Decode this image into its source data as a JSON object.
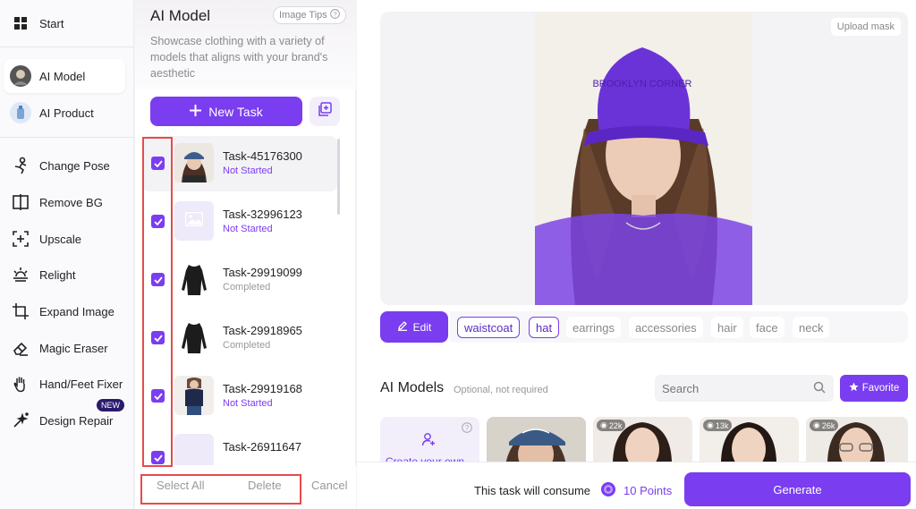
{
  "sidebar": {
    "items": [
      {
        "label": "Start",
        "icon": "grid-icon"
      },
      {
        "label": "AI Model",
        "icon": "model-avatar-icon"
      },
      {
        "label": "AI Product",
        "icon": "product-icon"
      },
      {
        "label": "Change Pose",
        "icon": "pose-icon"
      },
      {
        "label": "Remove BG",
        "icon": "remove-bg-icon"
      },
      {
        "label": "Upscale",
        "icon": "upscale-icon"
      },
      {
        "label": "Relight",
        "icon": "relight-icon"
      },
      {
        "label": "Expand Image",
        "icon": "expand-icon"
      },
      {
        "label": "Magic Eraser",
        "icon": "eraser-icon"
      },
      {
        "label": "Hand/Feet Fixer",
        "icon": "hand-icon"
      },
      {
        "label": "Design Repair",
        "icon": "repair-icon"
      }
    ],
    "new_badge": "NEW"
  },
  "panel": {
    "title": "AI Model",
    "tips_label": "Image Tips",
    "description": "Showcase clothing with a variety of models that aligns with your brand's aesthetic",
    "new_task_label": "New Task",
    "tasks": [
      {
        "name": "Task-45176300",
        "status": "Not Started"
      },
      {
        "name": "Task-32996123",
        "status": "Not Started"
      },
      {
        "name": "Task-29919099",
        "status": "Completed"
      },
      {
        "name": "Task-29918965",
        "status": "Completed"
      },
      {
        "name": "Task-29919168",
        "status": "Not Started"
      },
      {
        "name": "Task-26911647",
        "status": ""
      }
    ],
    "select_all": "Select All",
    "delete": "Delete",
    "cancel": "Cancel"
  },
  "main": {
    "upload_mask": "Upload mask",
    "cap_text": "BROOKLYN CORNER",
    "edit_label": "Edit",
    "tags": [
      {
        "label": "waistcoat",
        "selected": true
      },
      {
        "label": "hat",
        "selected": true
      },
      {
        "label": "earrings",
        "selected": false
      },
      {
        "label": "accessories",
        "selected": false
      },
      {
        "label": "hair",
        "selected": false
      },
      {
        "label": "face",
        "selected": false
      },
      {
        "label": "neck",
        "selected": false
      }
    ],
    "models_title": "AI Models",
    "models_sub": "Optional, not required",
    "search_placeholder": "Search",
    "favorite_label": "Favorite",
    "create_label": "Create your own",
    "model_counts": [
      "22k",
      "13k",
      "26k"
    ],
    "consume_text": "This task will consume",
    "points": "10 Points",
    "generate": "Generate"
  },
  "colors": {
    "accent": "#7a3df0",
    "highlight": "#e84a4a"
  }
}
